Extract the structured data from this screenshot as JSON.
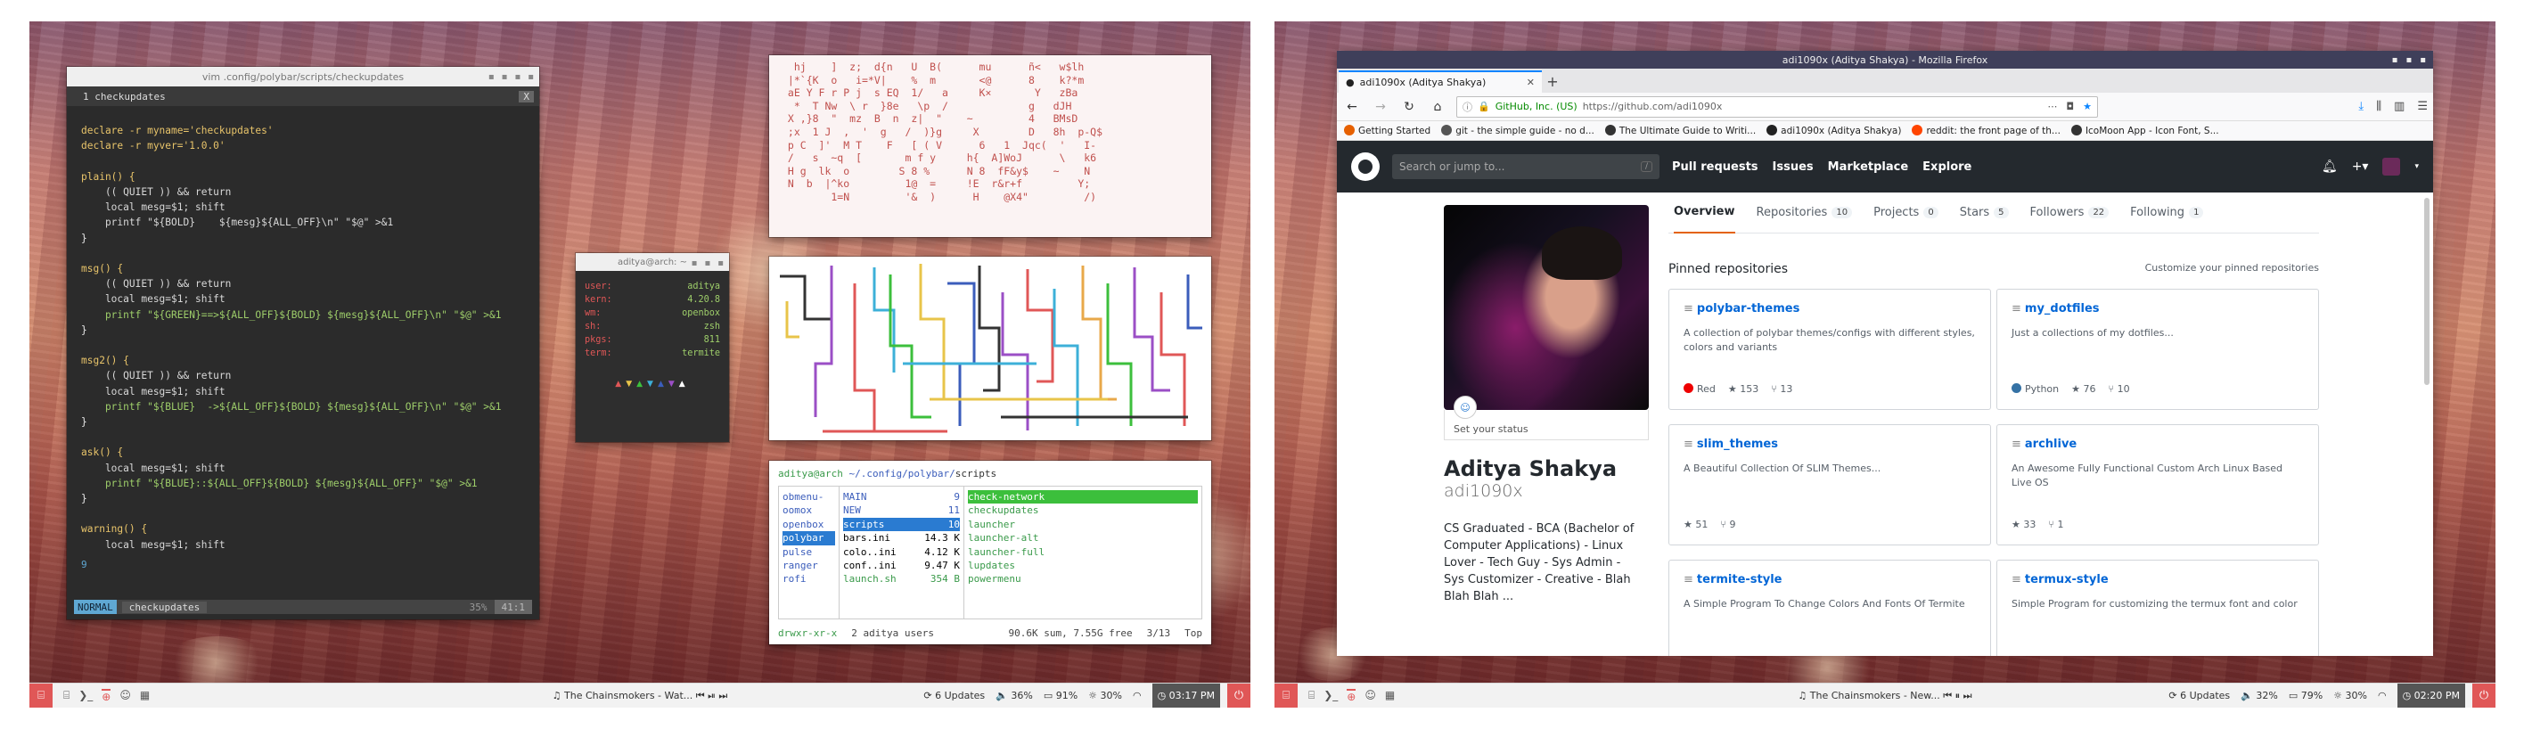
{
  "left": {
    "vim": {
      "title": "vim .config/polybar/scripts/checkupdates",
      "tab_label": "1 checkupdates",
      "tab_close": "X",
      "code_lines": [
        "",
        "declare -r myname='checkupdates'",
        "declare -r myver='1.0.0'",
        "",
        "plain() {",
        "    (( QUIET )) && return",
        "    local mesg=$1; shift",
        "    printf \"${BOLD}    ${mesg}${ALL_OFF}\\n\" \"$@\" >&1",
        "}",
        "",
        "msg() {",
        "    (( QUIET )) && return",
        "    local mesg=$1; shift",
        "    printf \"${GREEN}==>${ALL_OFF}${BOLD} ${mesg}${ALL_OFF}\\n\" \"$@\" >&1",
        "}",
        "",
        "msg2() {",
        "    (( QUIET )) && return",
        "    local mesg=$1; shift",
        "    printf \"${BLUE}  ->${ALL_OFF}${BOLD} ${mesg}${ALL_OFF}\\n\" \"$@\" >&1",
        "}",
        "",
        "ask() {",
        "    local mesg=$1; shift",
        "    printf \"${BLUE}::${ALL_OFF}${BOLD} ${mesg}${ALL_OFF}\" \"$@\" >&1",
        "}",
        "",
        "warning() {",
        "    local mesg=$1; shift"
      ],
      "line_number": "9",
      "mode": "NORMAL",
      "file": "checkupdates",
      "percent": "35%",
      "position": "41:1"
    },
    "neofetch": {
      "title": "aditya@arch: ~",
      "rows": [
        {
          "k": "user:",
          "v": "aditya"
        },
        {
          "k": "kern:",
          "v": "4.20.8"
        },
        {
          "k": "wm:",
          "v": "openbox"
        },
        {
          "k": "sh:",
          "v": "zsh"
        },
        {
          "k": "pkgs:",
          "v": "811"
        },
        {
          "k": "term:",
          "v": "termite"
        }
      ],
      "triangles": "▲▼▲▼▲▼▲"
    },
    "cmatrix_lines": [
      "  hj    ]  z;  d{n   U  B(      mu      ñ<   w$lh",
      " |*`{K  o   i=*V|    %  m       <@      8    k?*m",
      " aE Y F r P j  s EQ  1/   a     K×       Y   zBa",
      "  *  T Nw  \\ r  }8e   \\p  /             g   dJH",
      " X ,}8  \"  mz  B  n  z|  \"    ~         4   BMsD",
      " ;x  1 J  ,  '  g   /  )}g     X        D   8h  p-Q$",
      " p C  ]'  M T    F   [ ( V      6   1  Jqc(  '   I-",
      " /   s  ~q  [       m f y     h{  A]WoJ      \\   k6",
      " H g  lk  o        S 8 %      N 8  fF&y$    ~    N",
      " N  b  |^ko         1@  =     !E  r&r+f         Y;",
      "        1=N         '&  )      H    @X4\"         /)"
    ],
    "ranger": {
      "user": "aditya@arch",
      "path": " ~/.config/polybar/",
      "cwd": "scripts",
      "col1": [
        "obmenu-",
        "oomox",
        "openbox",
        "polybar",
        "pulse",
        "ranger",
        "rofi"
      ],
      "col1_selected": 3,
      "col2": [
        {
          "n": "MAIN",
          "s": "9"
        },
        {
          "n": "NEW",
          "s": "11"
        },
        {
          "n": "scripts",
          "s": "10"
        },
        {
          "n": "bars.ini",
          "s": "14.3 K"
        },
        {
          "n": "colo..ini",
          "s": "4.12 K"
        },
        {
          "n": "conf..ini",
          "s": "9.47 K"
        },
        {
          "n": "launch.sh",
          "s": "354 B"
        }
      ],
      "col2_selected": 2,
      "col3": [
        "check-network",
        "checkupdates",
        "launcher",
        "launcher-alt",
        "launcher-full",
        "lupdates",
        "powermenu"
      ],
      "col3_selected": 0,
      "footer_perm": "drwxr-xr-x",
      "footer_owner": "2 aditya users",
      "footer_size": "90.6K sum, 7.55G free",
      "footer_pos": "3/13",
      "footer_top": "Top"
    },
    "bar": {
      "workspaces": [
        "⌸",
        "❯_",
        "⊕",
        "☺",
        "▦"
      ],
      "media": "♫ The Chainsmokers - Wat...  ⏮ ⏯ ⏭",
      "updates": "⟳ 6 Updates",
      "volume": "🔈 36%",
      "battery": "▭ 91%",
      "brightness": "☼ 30%",
      "wifi": "◠",
      "time": "◷ 03:17 PM",
      "power": "⏻"
    }
  },
  "right": {
    "window_title": "adi1090x (Aditya Shakya) - Mozilla Firefox",
    "tab_title": "adi1090x (Aditya Shakya)",
    "identity": "GitHub, Inc. (US)",
    "url": "https://github.com/adi1090x",
    "bookmarks": [
      "Getting Started",
      "git - the simple guide - no d...",
      "The Ultimate Guide to Writi...",
      "adi1090x (Aditya Shakya)",
      "reddit: the front page of th...",
      "IcoMoon App - Icon Font, S..."
    ],
    "github": {
      "search_placeholder": "Search or jump to...",
      "slash": "/",
      "nav": [
        "Pull requests",
        "Issues",
        "Marketplace",
        "Explore"
      ],
      "set_status": "Set your status",
      "name": "Aditya Shakya",
      "username": "adi1090x",
      "bio": "CS Graduated - BCA (Bachelor of Computer Applications) - Linux Lover - Tech Guy - Sys Admin - Sys Customizer - Creative - Blah Blah Blah ...",
      "tabs": [
        {
          "label": "Overview",
          "count": ""
        },
        {
          "label": "Repositories",
          "count": "10"
        },
        {
          "label": "Projects",
          "count": "0"
        },
        {
          "label": "Stars",
          "count": "5"
        },
        {
          "label": "Followers",
          "count": "22"
        },
        {
          "label": "Following",
          "count": "1"
        }
      ],
      "pinned_title": "Pinned repositories",
      "customize": "Customize your pinned repositories",
      "repos": [
        {
          "name": "polybar-themes",
          "desc": "A collection of polybar themes/configs with different styles, colors and variants",
          "lang": "Red",
          "lang_color": "#ee0000",
          "stars": "153",
          "forks": "13"
        },
        {
          "name": "my_dotfiles",
          "desc": "Just a collections of my dotfiles...",
          "lang": "Python",
          "lang_color": "#3572A5",
          "stars": "76",
          "forks": "10"
        },
        {
          "name": "slim_themes",
          "desc": "A Beautiful Collection Of SLIM Themes...",
          "lang": "",
          "lang_color": "",
          "stars": "51",
          "forks": "9"
        },
        {
          "name": "archlive",
          "desc": "An Awesome Fully Functional Custom Arch Linux Based Live OS",
          "lang": "",
          "lang_color": "",
          "stars": "33",
          "forks": "1"
        },
        {
          "name": "termite-style",
          "desc": "A Simple Program To Change Colors And Fonts Of Termite",
          "lang": "",
          "lang_color": "",
          "stars": "",
          "forks": ""
        },
        {
          "name": "termux-style",
          "desc": "Simple Program for customizing the termux font and color",
          "lang": "",
          "lang_color": "",
          "stars": "",
          "forks": ""
        }
      ]
    },
    "bar": {
      "workspaces": [
        "⌸",
        "❯_",
        "⊕",
        "☺",
        "▦"
      ],
      "media": "♫ The Chainsmokers - New...  ⏮ ⏸ ⏭",
      "updates": "⟳ 6 Updates",
      "volume": "🔈 32%",
      "battery": "▭ 79%",
      "brightness": "☼ 30%",
      "wifi": "◠",
      "time": "◷ 02:20 PM",
      "power": "⏻"
    }
  }
}
